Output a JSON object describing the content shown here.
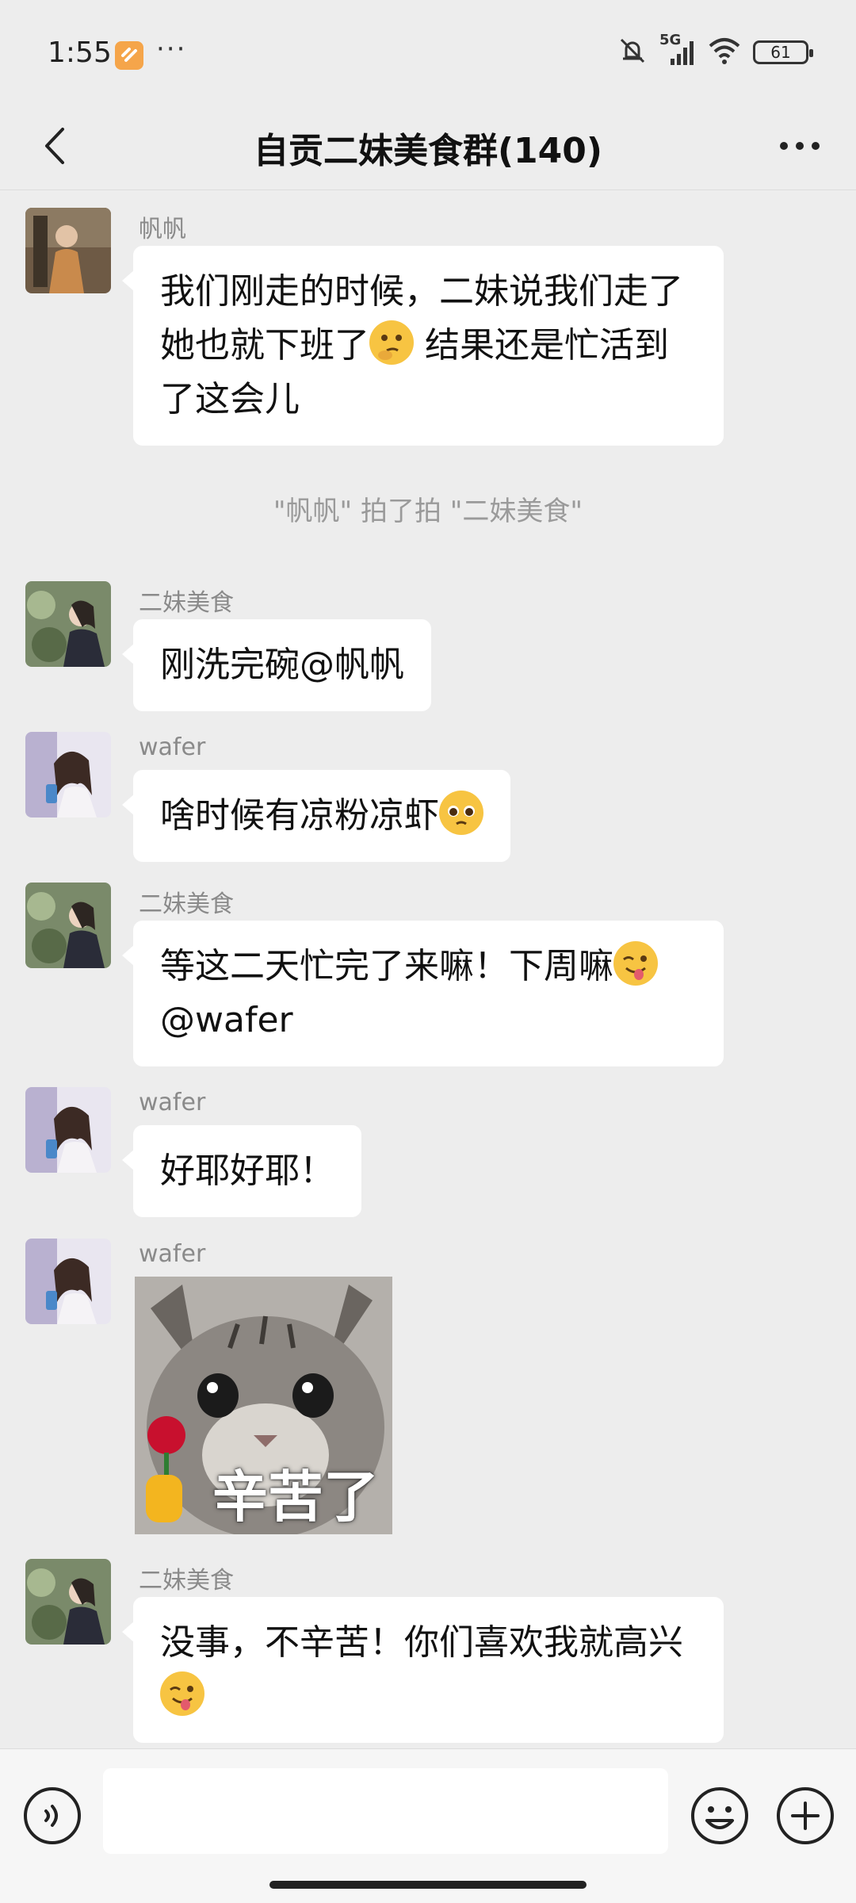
{
  "status_bar": {
    "time": "1:55",
    "dots": "···",
    "network": "5G",
    "battery": "61"
  },
  "header": {
    "title": "自贡二妹美食群(140)"
  },
  "messages": [
    {
      "sender": "帆帆",
      "text_a": "我们刚走的时候，二妹说我们走了她也就下班了",
      "emoji": "thinking-face-emoji",
      "text_b": " 结果还是忙活到了这会儿"
    },
    {
      "system": "\"帆帆\" 拍了拍 \"二妹美食\""
    },
    {
      "sender": "二妹美食",
      "text": "刚洗完碗@帆帆"
    },
    {
      "sender": "wafer",
      "text": "啥时候有凉粉凉虾",
      "emoji": "pleading-face-emoji"
    },
    {
      "sender": "二妹美食",
      "text_a": "等这二天忙完了来嘛！下周嘛",
      "emoji": "winking-tongue-emoji",
      "text_b": "@wafer"
    },
    {
      "sender": "wafer",
      "text": "好耶好耶！"
    },
    {
      "sender": "wafer",
      "sticker_caption": "辛苦了",
      "sticker": "cat-with-rose-sticker"
    },
    {
      "sender": "二妹美食",
      "text": "没事，不辛苦！你们喜欢我就高兴",
      "emoji": "winking-tongue-emoji"
    }
  ],
  "input": {
    "placeholder": ""
  },
  "colors": {
    "background": "#ededed",
    "bubble": "#ffffff",
    "sender_name": "#8a8a8a"
  }
}
